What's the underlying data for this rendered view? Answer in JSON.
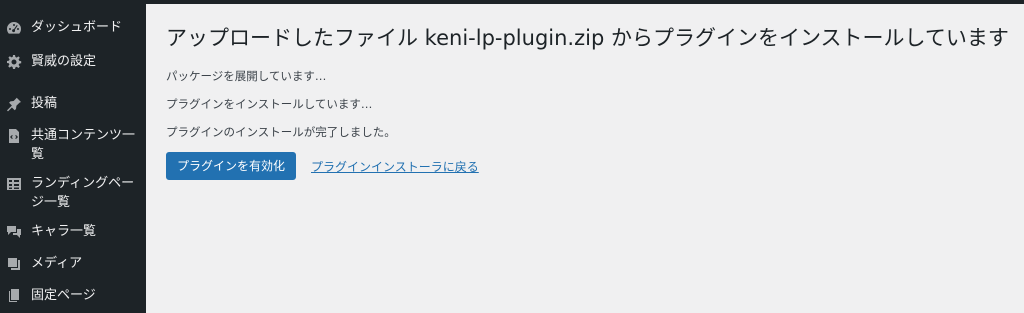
{
  "sidebar": {
    "items": [
      {
        "label": "ダッシュボード",
        "icon": "dashboard-icon"
      },
      {
        "label": "賢威の設定",
        "icon": "gear-icon"
      },
      {
        "label": "投稿",
        "icon": "pin-icon"
      },
      {
        "label": "共通コンテンツ一覧",
        "icon": "code-file-icon"
      },
      {
        "label": "ランディングページ一覧",
        "icon": "table-icon"
      },
      {
        "label": "キャラ一覧",
        "icon": "chat-bubbles-icon"
      },
      {
        "label": "メディア",
        "icon": "media-icon"
      },
      {
        "label": "固定ページ",
        "icon": "pages-icon"
      }
    ]
  },
  "main": {
    "title": "アップロードしたファイル keni-lp-plugin.zip からプラグインをインストールしています",
    "messages": [
      "パッケージを展開しています…",
      "プラグインをインストールしています…",
      "プラグインのインストールが完了しました。"
    ],
    "activate_button": "プラグインを有効化",
    "return_link": "プラグインインストーラに戻る"
  },
  "colors": {
    "sidebar_bg": "#1d2327",
    "content_bg": "#f0f0f1",
    "primary": "#2271b1"
  }
}
